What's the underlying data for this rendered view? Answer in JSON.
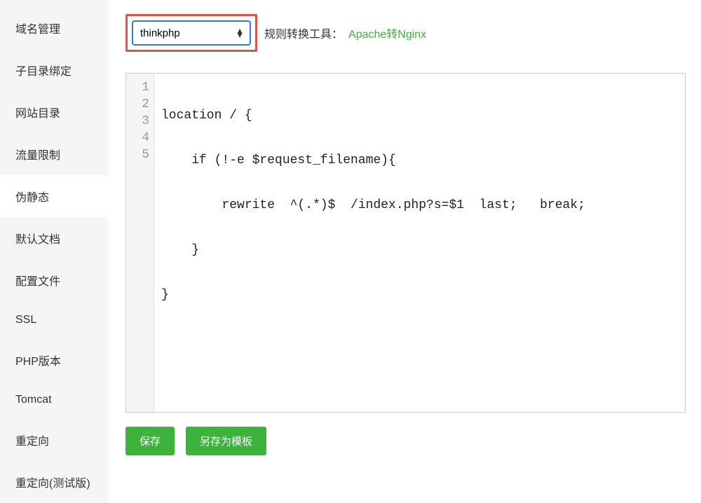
{
  "sidebar": {
    "items": [
      {
        "label": "域名管理",
        "active": false
      },
      {
        "label": "子目录绑定",
        "active": false
      },
      {
        "label": "网站目录",
        "active": false
      },
      {
        "label": "流量限制",
        "active": false
      },
      {
        "label": "伪静态",
        "active": true
      },
      {
        "label": "默认文档",
        "active": false
      },
      {
        "label": "配置文件",
        "active": false
      },
      {
        "label": "SSL",
        "active": false
      },
      {
        "label": "PHP版本",
        "active": false
      },
      {
        "label": "Tomcat",
        "active": false
      },
      {
        "label": "重定向",
        "active": false
      },
      {
        "label": "重定向(测试版)",
        "active": false
      }
    ]
  },
  "toolbar": {
    "select_value": "thinkphp",
    "tool_label": "规则转换工具：",
    "tool_link": "Apache转Nginx"
  },
  "editor": {
    "lines": [
      "location / {",
      "    if (!-e $request_filename){",
      "        rewrite  ^(.*)$  /index.php?s=$1  last;   break;",
      "    }",
      "}"
    ]
  },
  "buttons": {
    "save": "保存",
    "save_as_template": "另存为模板"
  }
}
